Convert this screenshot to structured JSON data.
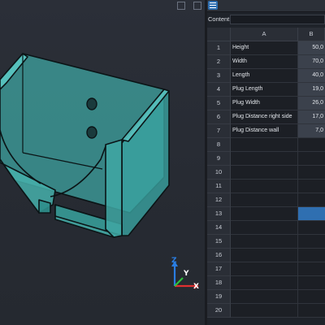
{
  "viewport": {
    "axes": {
      "z": "Z",
      "y": "Y",
      "x": "X"
    }
  },
  "sheet": {
    "content_label": "Content:",
    "content_value": "",
    "columns": [
      "A",
      "B"
    ],
    "rows": [
      {
        "n": "1",
        "a": "Height",
        "b": "50,0"
      },
      {
        "n": "2",
        "a": "Width",
        "b": "70,0"
      },
      {
        "n": "3",
        "a": "Length",
        "b": "40,0"
      },
      {
        "n": "4",
        "a": "Plug Length",
        "b": "19,0"
      },
      {
        "n": "5",
        "a": "Plug Width",
        "b": "26,0"
      },
      {
        "n": "6",
        "a": "Plug Distance right side",
        "b": "17,0"
      },
      {
        "n": "7",
        "a": "Plug Distance wall",
        "b": "7,0"
      },
      {
        "n": "8",
        "a": "",
        "b": ""
      },
      {
        "n": "9",
        "a": "",
        "b": ""
      },
      {
        "n": "10",
        "a": "",
        "b": ""
      },
      {
        "n": "11",
        "a": "",
        "b": ""
      },
      {
        "n": "12",
        "a": "",
        "b": ""
      },
      {
        "n": "13",
        "a": "",
        "b": ""
      },
      {
        "n": "14",
        "a": "",
        "b": ""
      },
      {
        "n": "15",
        "a": "",
        "b": ""
      },
      {
        "n": "16",
        "a": "",
        "b": ""
      },
      {
        "n": "17",
        "a": "",
        "b": ""
      },
      {
        "n": "18",
        "a": "",
        "b": ""
      },
      {
        "n": "19",
        "a": "",
        "b": ""
      },
      {
        "n": "20",
        "a": "",
        "b": ""
      }
    ],
    "selected_row": "13"
  },
  "colors": {
    "model_fill": "#3fa7a3",
    "model_edge": "#0b1416",
    "selection": "#2f6fb1"
  }
}
